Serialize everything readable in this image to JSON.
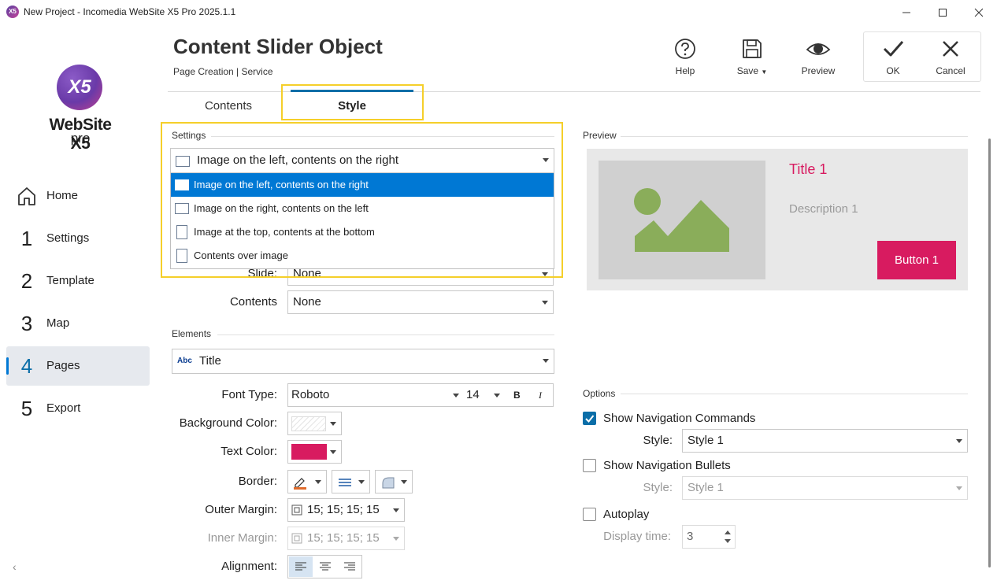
{
  "window": {
    "title": "New Project - Incomedia WebSite X5 Pro 2025.1.1",
    "app_icon_text": "X5"
  },
  "sidebar": {
    "logo_mark": "X5",
    "logo_text": "WebSite X5",
    "logo_sub": "pro",
    "items": [
      {
        "num": "",
        "label": "Home",
        "icon": "home-icon"
      },
      {
        "num": "1",
        "label": "Settings"
      },
      {
        "num": "2",
        "label": "Template"
      },
      {
        "num": "3",
        "label": "Map"
      },
      {
        "num": "4",
        "label": "Pages",
        "active": true
      },
      {
        "num": "5",
        "label": "Export"
      }
    ],
    "collapse_glyph": "‹"
  },
  "header": {
    "title": "Content Slider Object",
    "breadcrumb": "Page Creation | Service",
    "buttons": {
      "help": "Help",
      "save": "Save",
      "preview": "Preview",
      "ok": "OK",
      "cancel": "Cancel"
    }
  },
  "tabs": [
    {
      "label": "Contents"
    },
    {
      "label": "Style",
      "active": true
    }
  ],
  "settings": {
    "section": "Settings",
    "layout_selected": "Image on the left, contents on the right",
    "layout_options": [
      "Image on the left, contents on the right",
      "Image on the right, contents on the left",
      "Image at the top, contents at the bottom",
      "Contents over image"
    ],
    "slide_label": "Slide:",
    "slide_value": "None",
    "contents_label": "Contents",
    "contents_value": "None"
  },
  "elements": {
    "section": "Elements",
    "element_icon_text": "Abc",
    "element_selected": "Title",
    "font_type_label": "Font Type:",
    "font_name": "Roboto",
    "font_size": "14",
    "bold_glyph": "B",
    "italic_glyph": "I",
    "bg_color_label": "Background Color:",
    "text_color_label": "Text Color:",
    "text_color": "#d81b60",
    "border_label": "Border:",
    "outer_margin_label": "Outer Margin:",
    "outer_margin_value": "15; 15; 15; 15",
    "inner_margin_label": "Inner Margin:",
    "inner_margin_value": "15; 15; 15; 15",
    "alignment_label": "Alignment:"
  },
  "preview": {
    "section": "Preview",
    "title": "Title 1",
    "description": "Description 1",
    "button": "Button 1",
    "accent": "#d81b60",
    "image_color": "#8aad5a"
  },
  "options": {
    "section": "Options",
    "show_nav_commands": "Show Navigation Commands",
    "show_nav_commands_checked": true,
    "style_label": "Style:",
    "nav_style": "Style 1",
    "show_nav_bullets": "Show Navigation Bullets",
    "show_nav_bullets_checked": false,
    "bullets_style_label": "Style:",
    "bullets_style": "Style 1",
    "autoplay": "Autoplay",
    "autoplay_checked": false,
    "display_time_label": "Display time:",
    "display_time": "3"
  }
}
